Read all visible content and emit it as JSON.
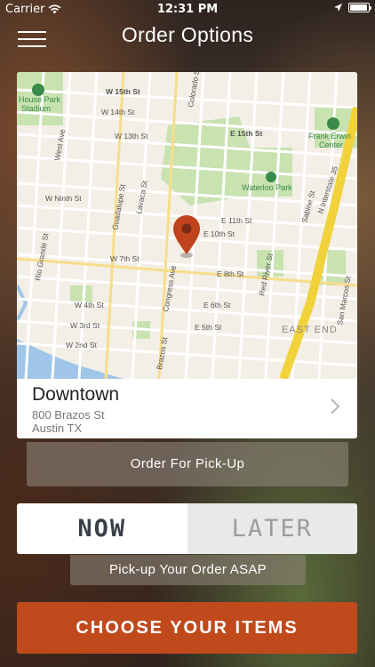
{
  "status_bar": {
    "carrier": "Carrier",
    "time": "12:31 PM"
  },
  "nav": {
    "title": "Order Options",
    "menu_icon": "hamburger-menu-icon"
  },
  "map": {
    "labels": {
      "w15th": "W 15th St",
      "w14th": "W 14th St",
      "w13th": "W 13th St",
      "e15th": "E 15th St",
      "westave": "West Ave",
      "guadalupe": "Guadalupe St",
      "lavaca": "Lavaca St",
      "colorado": "Colorado St",
      "wninth": "W Ninth St",
      "e11th": "E 11th St",
      "e10th": "E 10th St",
      "riogrande": "Rio Grande St",
      "w7th": "W 7th St",
      "e8th": "E 8th St",
      "congress": "Congress Ave",
      "e6th": "E 6th St",
      "w4th": "W 4th St",
      "w3rd": "W 3rd St",
      "w2nd": "W 2nd St",
      "e5th": "E 5th St",
      "brazos": "Brazos St",
      "redriver": "Red River St",
      "sabine": "Sabine St",
      "interstate": "N Interstate 35",
      "sanmarcos": "San Marcos St",
      "eastend": "EAST END",
      "houseparkline1": "House Park",
      "houseparkline2": "Stadium",
      "franklin1": "Frank Erwin",
      "franklin2": "Center",
      "waterloo": "Waterloo Park"
    },
    "pin_icon": "map-pin-icon"
  },
  "location": {
    "name": "Downtown",
    "address_line1": "800 Brazos St",
    "address_line2": "Austin TX"
  },
  "order_type": "Order For Pick-Up",
  "timing": {
    "now": "NOW",
    "later": "LATER",
    "selected": "NOW"
  },
  "pickup_note": "Pick-up Your Order ASAP",
  "cta": "CHOOSE YOUR ITEMS",
  "colors": {
    "accent": "#c04a1c",
    "pin": "#c0431d",
    "highway": "#f2d23a"
  }
}
